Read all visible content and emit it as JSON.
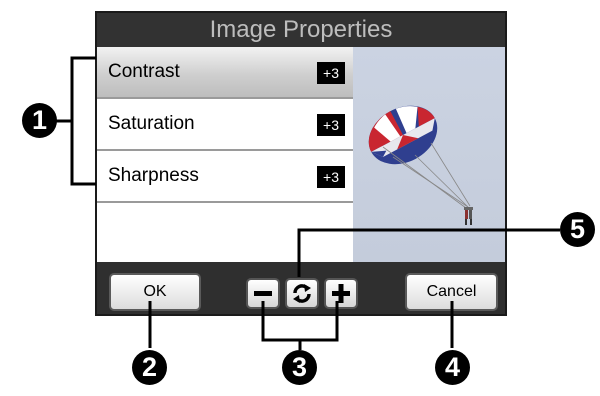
{
  "dialog": {
    "title": "Image Properties"
  },
  "properties": [
    {
      "label": "Contrast",
      "value": "+3",
      "selected": true
    },
    {
      "label": "Saturation",
      "value": "+3",
      "selected": false
    },
    {
      "label": "Sharpness",
      "value": "+3",
      "selected": false
    }
  ],
  "buttons": {
    "ok_label": "OK",
    "cancel_label": "Cancel",
    "decrease_icon": "minus-icon",
    "reset_icon": "refresh-icon",
    "increase_icon": "plus-icon"
  },
  "callouts": [
    "1",
    "2",
    "3",
    "4",
    "5"
  ],
  "colors": {
    "title_bar": "#323232",
    "bottom_bar": "#2f2f2f",
    "value_badge": "#000000"
  }
}
